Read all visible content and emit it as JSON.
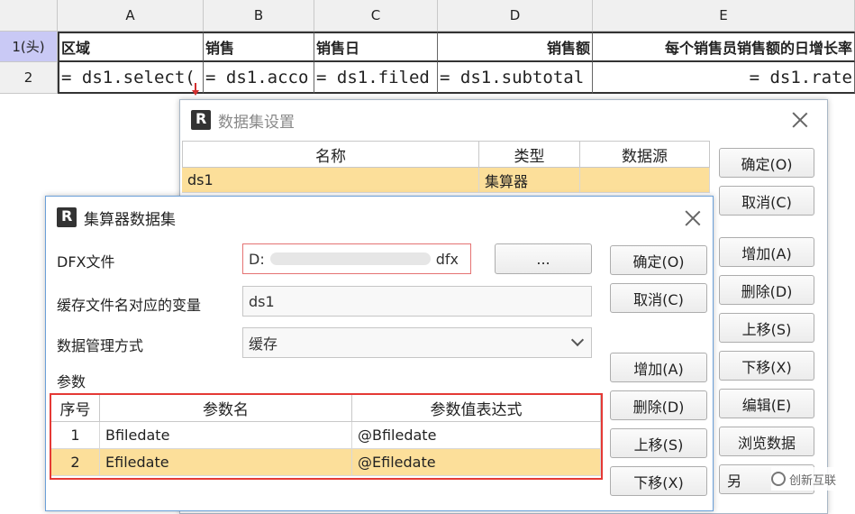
{
  "sheet": {
    "columns": [
      "A",
      "B",
      "C",
      "D",
      "E"
    ],
    "rows": [
      {
        "header": "1(头)",
        "cells": [
          "区域",
          "销售",
          "销售日",
          "销售额",
          "每个销售员销售额的日增长率"
        ]
      },
      {
        "header": "2",
        "cells": [
          "= ds1.select(",
          "= ds1.acco",
          "= ds1.filed",
          "= ds1.subtotal",
          "= ds1.rate"
        ]
      }
    ]
  },
  "dataset_dialog": {
    "title": "数据集设置",
    "table_headers": [
      "名称",
      "类型",
      "数据源"
    ],
    "rows": [
      {
        "name": "ds1",
        "type": "集算器",
        "source": ""
      }
    ],
    "buttons": [
      "确定(O)",
      "取消(C)",
      "增加(A)",
      "删除(D)",
      "上移(S)",
      "下移(X)",
      "编辑(E)",
      "浏览数据",
      "另"
    ]
  },
  "calc_dialog": {
    "title": "集算器数据集",
    "dfx_label": "DFX文件",
    "dfx_value_prefix": "D:",
    "dfx_value_suffix": "dfx",
    "browse_label": "...",
    "cache_var_label": "缓存文件名对应的变量",
    "cache_var_value": "ds1",
    "mode_label": "数据管理方式",
    "mode_value": "缓存",
    "params_label": "参数",
    "param_headers": [
      "序号",
      "参数名",
      "参数值表达式"
    ],
    "params": [
      {
        "no": "1",
        "name": "Bfiledate",
        "expr": "@Bfiledate"
      },
      {
        "no": "2",
        "name": "Efiledate",
        "expr": "@Efiledate"
      }
    ],
    "buttons": [
      "确定(O)",
      "取消(C)",
      "增加(A)",
      "删除(D)",
      "上移(S)",
      "下移(X)"
    ]
  },
  "watermark": "创新互联",
  "colors": {
    "selected_row": "#fcdf9a",
    "highlight_border": "#e53935",
    "header_bg": "#f0f0f0",
    "row1_header_bg": "#c9c9f5"
  }
}
